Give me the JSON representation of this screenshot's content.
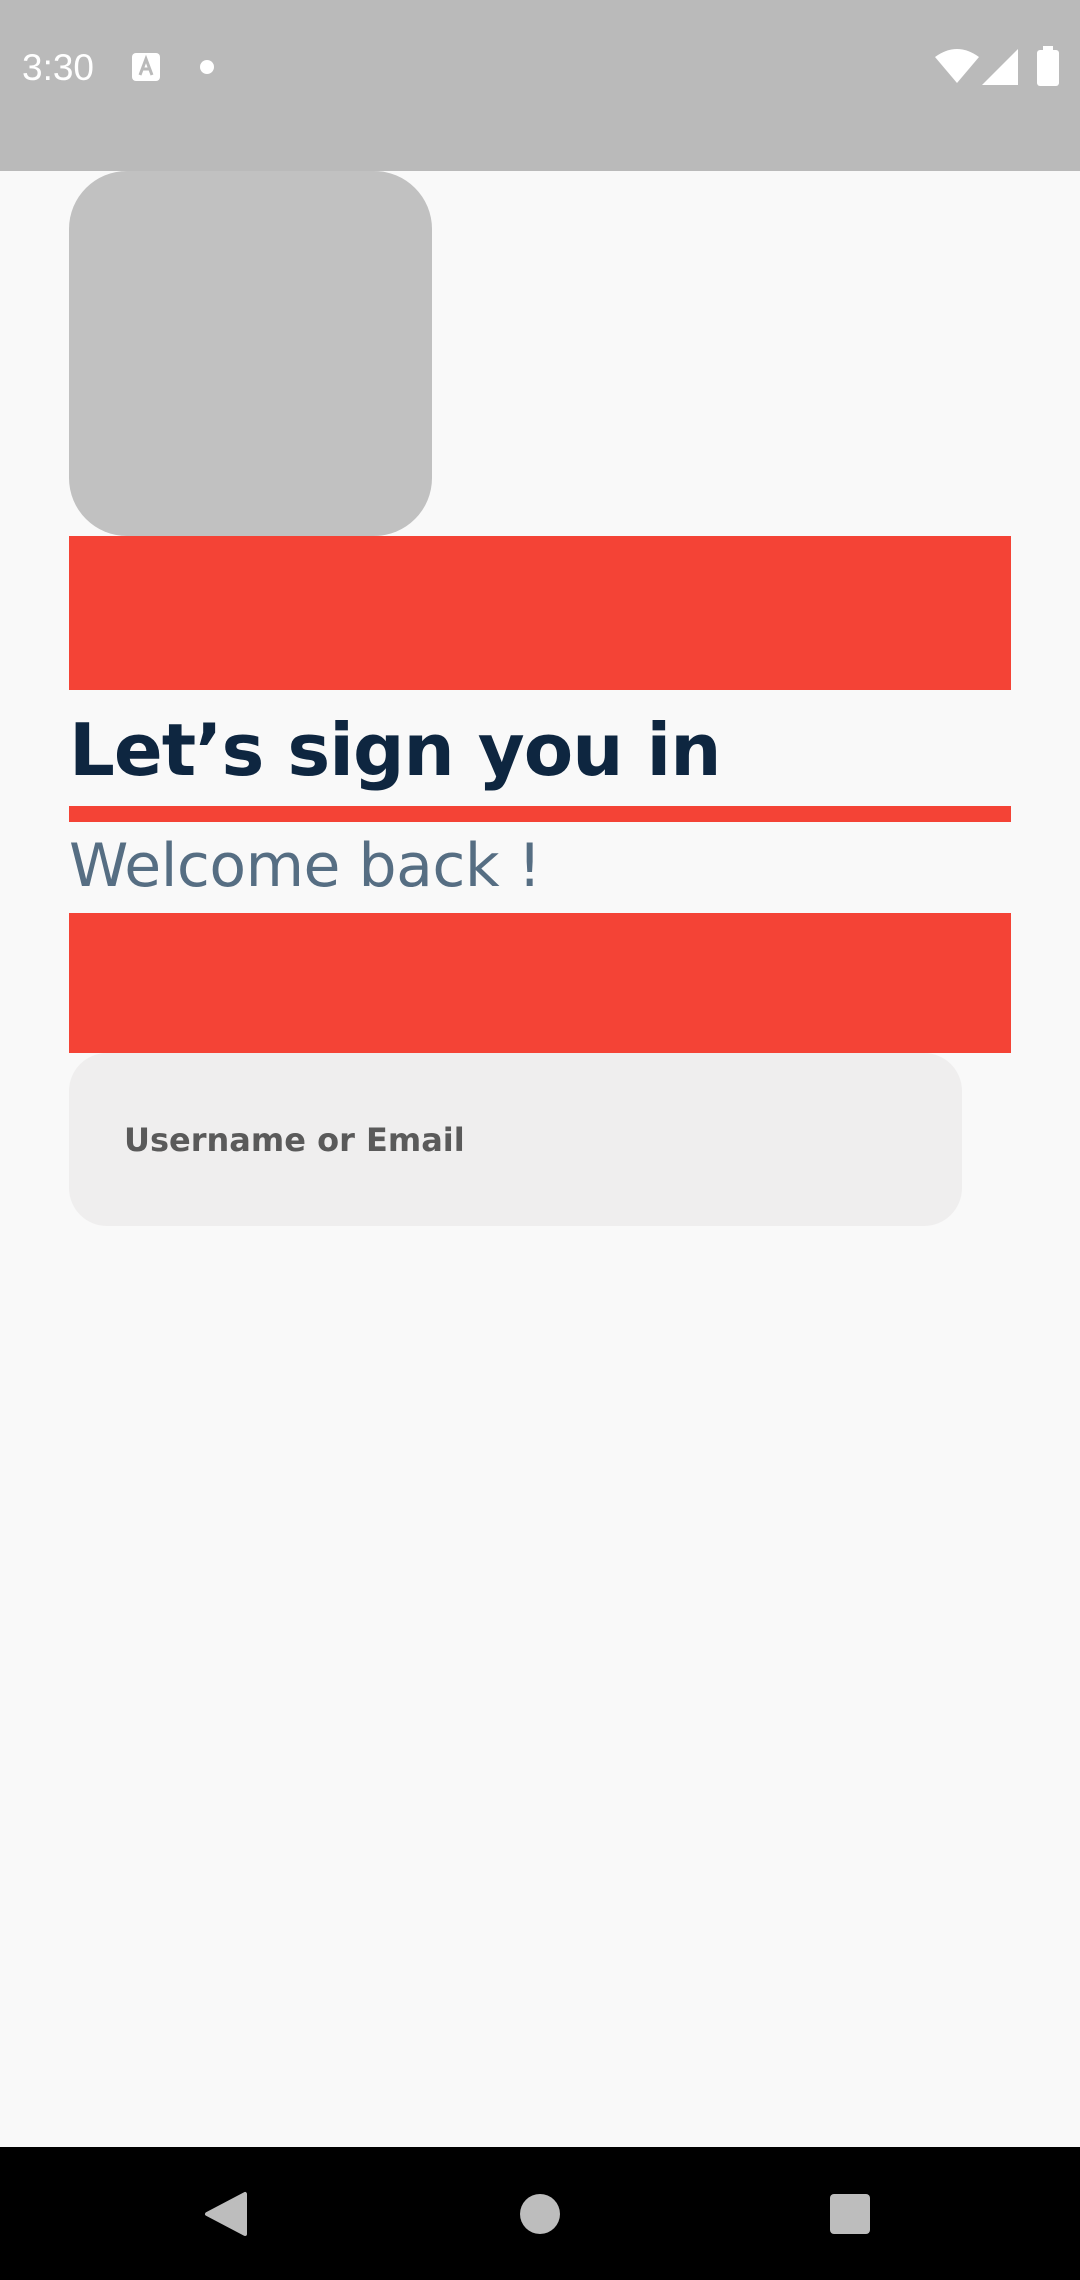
{
  "status_bar": {
    "time": "3:30",
    "icons": [
      "font-a-icon",
      "notification-dot-icon",
      "wifi-icon",
      "cell-signal-icon",
      "battery-icon"
    ]
  },
  "login": {
    "title": "Let’s sign you in",
    "subtitle": "Welcome back !",
    "username_placeholder": "Username or Email",
    "username_value": ""
  },
  "nav_bar": {
    "icons": [
      "back-icon",
      "home-icon",
      "recents-icon"
    ]
  },
  "colors": {
    "status_bar_bg": "#bababa",
    "background": "#f9f9f9",
    "logo_placeholder": "#c1c1c1",
    "spacer_red": "#f44336",
    "title": "#0e2640",
    "subtitle": "#566e83",
    "input_bg": "#efeeee",
    "placeholder_text": "#5a5a5a",
    "nav_bar_bg": "#000000"
  }
}
